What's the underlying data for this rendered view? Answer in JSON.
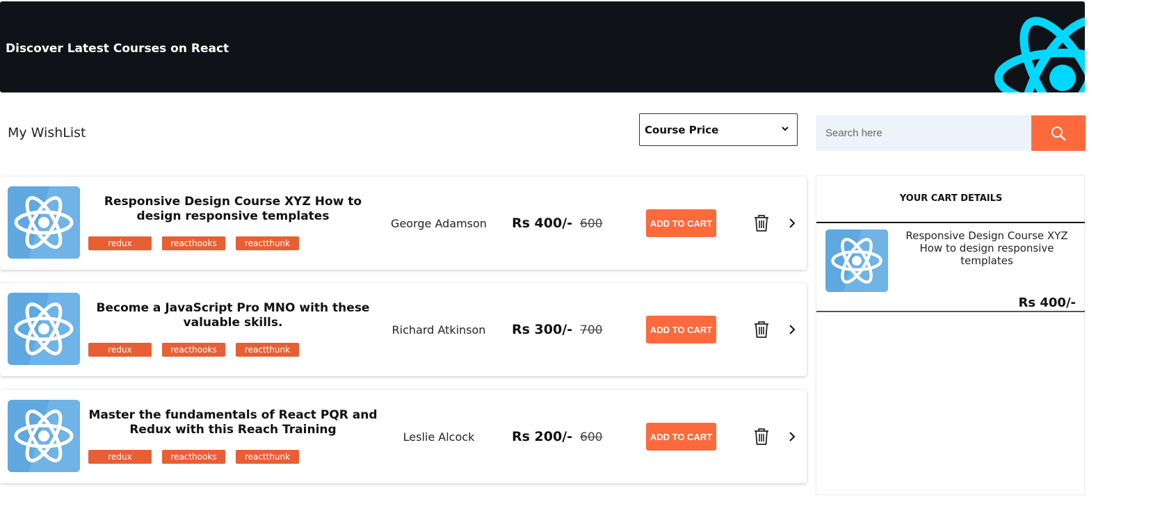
{
  "banner": {
    "title": "Discover Latest Courses on React"
  },
  "wishlist": {
    "title": "My WishList"
  },
  "sort": {
    "selected": "Course Price"
  },
  "search": {
    "placeholder": "Search here"
  },
  "courses": [
    {
      "title": "Responsive Design Course XYZ How to design responsive templates",
      "tags": [
        "redux",
        "reacthooks",
        "reactthunk"
      ],
      "author": "George Adamson",
      "price": "Rs 400/-",
      "old_price": "600",
      "cart_label": "ADD TO CART"
    },
    {
      "title": "Become a JavaScript Pro MNO with these valuable skills.",
      "tags": [
        "redux",
        "reacthooks",
        "reactthunk"
      ],
      "author": "Richard Atkinson",
      "price": "Rs 300/-",
      "old_price": "700",
      "cart_label": "ADD TO CART"
    },
    {
      "title": "Master the fundamentals of React PQR and Redux with this Reach Training",
      "tags": [
        "redux",
        "reacthooks",
        "reactthunk"
      ],
      "author": "Leslie Alcock",
      "price": "Rs 200/-",
      "old_price": "600",
      "cart_label": "ADD TO CART"
    }
  ],
  "cart": {
    "heading": "YOUR CART DETAILS",
    "items": [
      {
        "title": "Responsive Design Course XYZ How to design responsive templates",
        "price": "Rs 400/-"
      }
    ]
  },
  "colors": {
    "accent": "#ff6a3d",
    "tag": "#e85f34",
    "banner": "#0f1318",
    "react_cyan": "#00d8ff",
    "thumb_blue": "#5fa8e0"
  },
  "icons": [
    "react-logo-icon",
    "chevron-down-icon",
    "search-icon",
    "trash-icon",
    "chevron-right-icon"
  ]
}
